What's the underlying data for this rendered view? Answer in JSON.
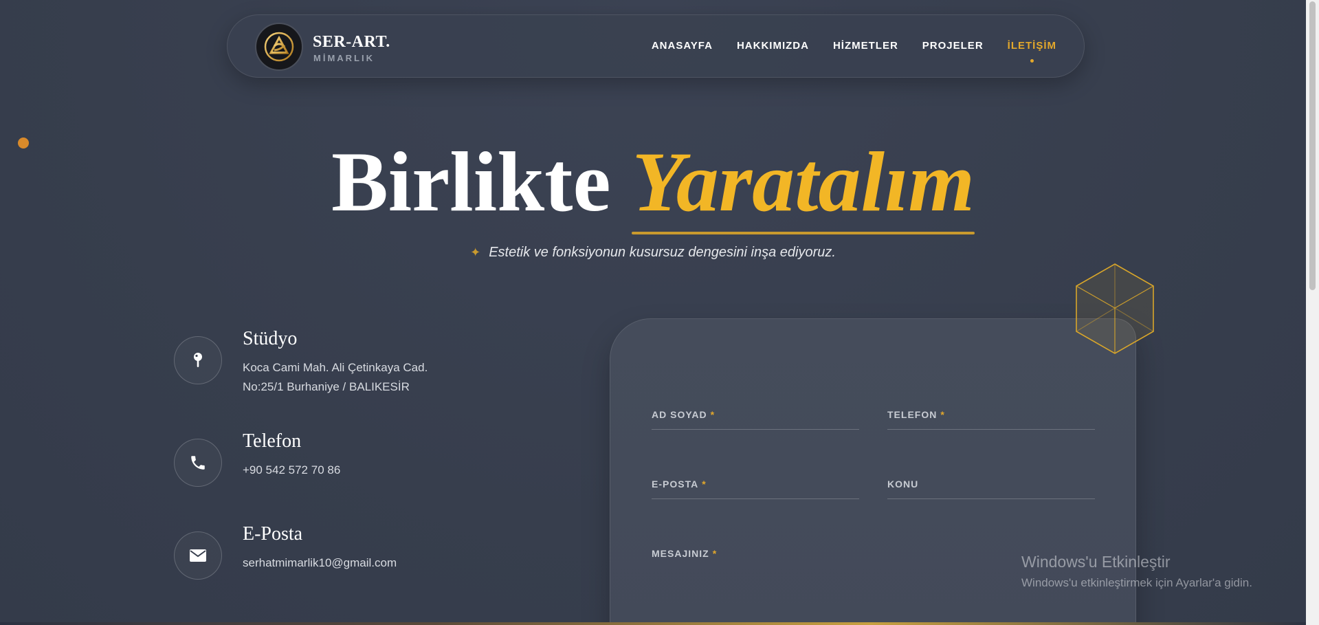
{
  "brand": {
    "name": "SER-ART.",
    "subtitle": "MİMARLIK"
  },
  "nav": {
    "items": [
      {
        "label": "ANASAYFA",
        "active": false
      },
      {
        "label": "HAKKIMIZDA",
        "active": false
      },
      {
        "label": "HİZMETLER",
        "active": false
      },
      {
        "label": "PROJELER",
        "active": false
      },
      {
        "label": "İLETİŞİM",
        "active": true
      }
    ]
  },
  "hero": {
    "title_plain": "Birlikte",
    "title_accent": "Yaratalım",
    "subtitle": "Estetik ve fonksiyonun kusursuz dengesini inşa ediyoruz."
  },
  "contact": {
    "studio": {
      "title": "Stüdyo",
      "line1": "Koca Cami Mah. Ali Çetinkaya Cad.",
      "line2": "No:25/1 Burhaniye / BALIKESİR",
      "icon": "map-pin-icon"
    },
    "phone": {
      "title": "Telefon",
      "value": "+90 542 572 70 86",
      "icon": "phone-icon"
    },
    "email": {
      "title": "E-Posta",
      "value": "serhatmimarlik10@gmail.com",
      "icon": "mail-icon"
    }
  },
  "form": {
    "name_label": "AD SOYAD",
    "phone_label": "TELEFON",
    "email_label": "E-POSTA",
    "subject_label": "KONU",
    "message_label": "MESAJINIZ",
    "required_mark": "*"
  },
  "watermark": {
    "title": "Windows'u Etkinleştir",
    "subtitle": "Windows'u etkinleştirmek için Ayarlar'a gidin."
  },
  "colors": {
    "accent": "#f2b626",
    "background": "#39404f",
    "dot": "#d98a2a"
  }
}
